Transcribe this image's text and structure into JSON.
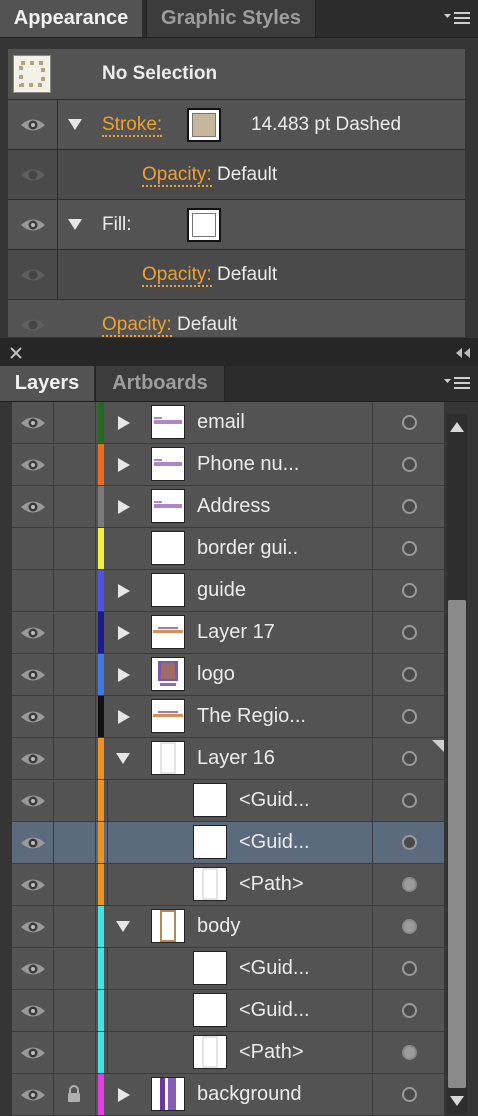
{
  "appearance": {
    "tabs": [
      "Appearance",
      "Graphic Styles"
    ],
    "selection_label": "No Selection",
    "stroke": {
      "label": "Stroke:",
      "value": "14.483 pt Dashed",
      "swatch_color": "#c6b69a"
    },
    "stroke_opacity": {
      "label": "Opacity:",
      "value": "Default"
    },
    "fill": {
      "label": "Fill:",
      "swatch_color": "#ffffff"
    },
    "fill_opacity": {
      "label": "Opacity:",
      "value": "Default"
    },
    "object_opacity": {
      "label": "Opacity:",
      "value": "Default"
    }
  },
  "layers_panel": {
    "tabs": [
      "Layers",
      "Artboards"
    ],
    "rows": [
      {
        "name": "email",
        "color": "#1f6b1f",
        "eye": true,
        "expand": "collapsed",
        "indent": 0,
        "thumb": "purple-line",
        "target": "hollow"
      },
      {
        "name": "Phone nu...",
        "color": "#f06a1e",
        "eye": true,
        "expand": "collapsed",
        "indent": 0,
        "thumb": "purple-line",
        "target": "hollow"
      },
      {
        "name": "Address",
        "color": "#7a7a7a",
        "eye": true,
        "expand": "collapsed",
        "indent": 0,
        "thumb": "purple-line",
        "target": "hollow"
      },
      {
        "name": "border gui..",
        "color": "#f2f23a",
        "eye": false,
        "expand": "none",
        "indent": 0,
        "thumb": "blank",
        "target": "hollow"
      },
      {
        "name": "guide",
        "color": "#4f52e6",
        "eye": false,
        "expand": "collapsed",
        "indent": 0,
        "thumb": "blank",
        "target": "hollow"
      },
      {
        "name": "Layer 17",
        "color": "#1a1a8f",
        "eye": true,
        "expand": "collapsed",
        "indent": 0,
        "thumb": "orange-line",
        "target": "hollow"
      },
      {
        "name": "logo",
        "color": "#3f78e6",
        "eye": true,
        "expand": "collapsed",
        "indent": 0,
        "thumb": "logo",
        "target": "hollow"
      },
      {
        "name": "The Regio...",
        "color": "#111111",
        "eye": true,
        "expand": "collapsed",
        "indent": 0,
        "thumb": "orange-line",
        "target": "hollow"
      },
      {
        "name": "Layer 16",
        "color": "#f0921e",
        "eye": true,
        "expand": "expanded",
        "indent": 0,
        "thumb": "frame",
        "target": "hollow"
      },
      {
        "name": "<Guid...",
        "color": "#f0921e",
        "eye": true,
        "expand": "none",
        "indent": 1,
        "thumb": "blank",
        "target": "hollow"
      },
      {
        "name": "<Guid...",
        "color": "#f0921e",
        "eye": true,
        "expand": "none",
        "indent": 1,
        "thumb": "blank",
        "target": "hollow",
        "selected": true
      },
      {
        "name": "<Path>",
        "color": "#f0921e",
        "eye": true,
        "expand": "none",
        "indent": 1,
        "thumb": "frame",
        "target": "filled"
      },
      {
        "name": "body",
        "color": "#3ee6e6",
        "eye": true,
        "expand": "expanded",
        "indent": 0,
        "thumb": "frame-brown",
        "target": "filled"
      },
      {
        "name": "<Guid...",
        "color": "#3ee6e6",
        "eye": true,
        "expand": "none",
        "indent": 1,
        "thumb": "blank",
        "target": "hollow"
      },
      {
        "name": "<Guid...",
        "color": "#3ee6e6",
        "eye": true,
        "expand": "none",
        "indent": 1,
        "thumb": "blank",
        "target": "hollow"
      },
      {
        "name": "<Path>",
        "color": "#3ee6e6",
        "eye": true,
        "expand": "none",
        "indent": 1,
        "thumb": "frame",
        "target": "filled"
      },
      {
        "name": "background",
        "color": "#e63ee6",
        "eye": true,
        "lock": true,
        "expand": "collapsed",
        "indent": 0,
        "thumb": "background",
        "target": "hollow"
      }
    ]
  }
}
